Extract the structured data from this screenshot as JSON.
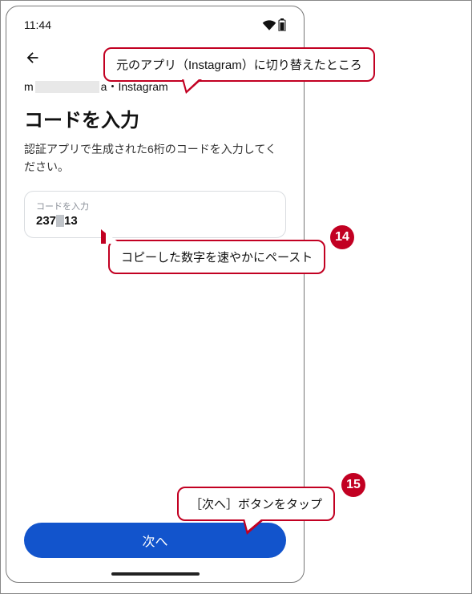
{
  "statusbar": {
    "time": "11:44"
  },
  "header": {
    "account_prefix": "m",
    "account_suffix": "a・Instagram",
    "title": "コードを入力",
    "description": "認証アプリで生成された6桁のコードを入力してください。"
  },
  "input": {
    "label": "コードを入力",
    "value_part1": "237",
    "value_part2": "13"
  },
  "button": {
    "next": "次へ"
  },
  "callouts": {
    "c1": "元のアプリ（Instagram）に切り替えたところ",
    "c2": "コピーした数字を速やかにペースト",
    "c3": "［次へ］ボタンをタップ"
  },
  "badges": {
    "b14": "14",
    "b15": "15"
  }
}
